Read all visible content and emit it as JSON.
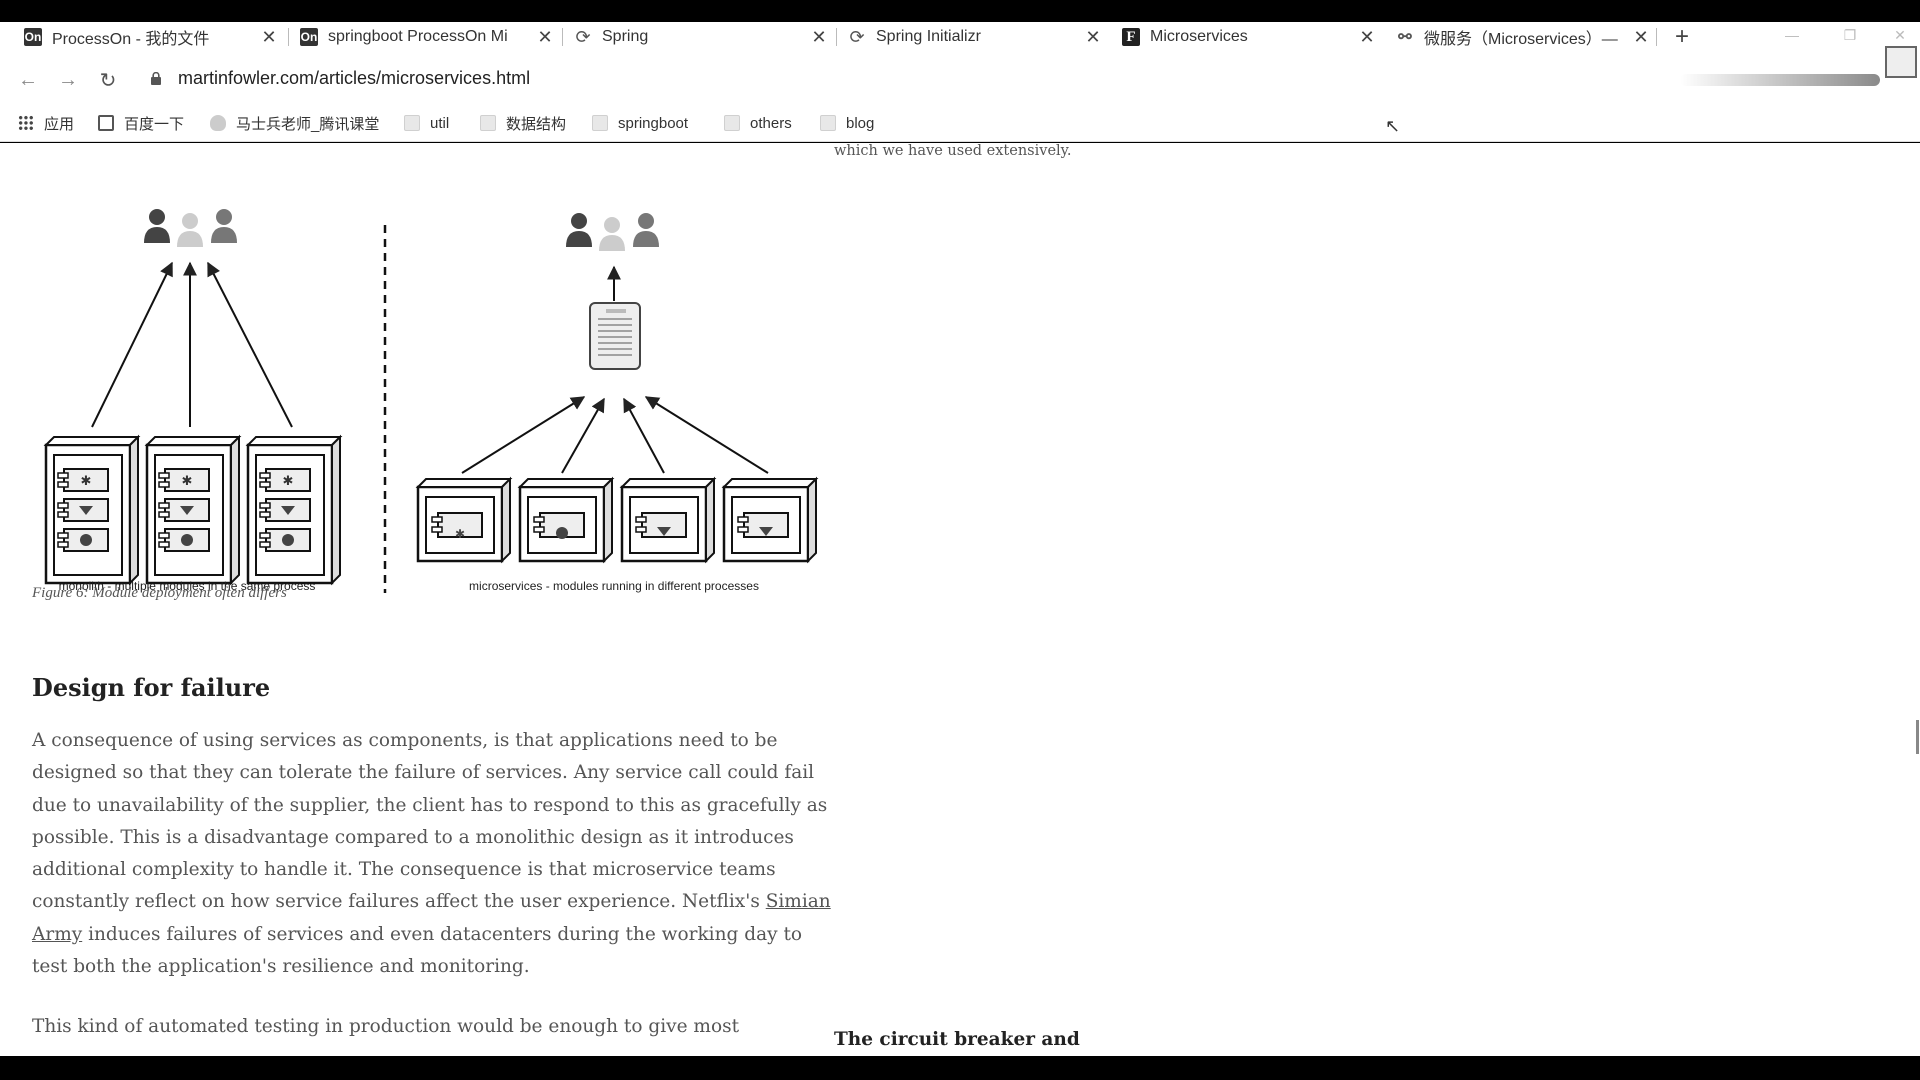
{
  "tabs": [
    {
      "title": "ProcessOn - 我的文件",
      "icon": "processon-icon"
    },
    {
      "title": "springboot ProcessOn Mi",
      "icon": "processon-icon"
    },
    {
      "title": "Spring",
      "icon": "spring-icon"
    },
    {
      "title": "Spring Initializr",
      "icon": "spring-initializr-icon"
    },
    {
      "title": "Microservices",
      "icon": "martinfowler-f-icon"
    },
    {
      "title": "微服务（Microservices）—",
      "icon": "link-icon"
    }
  ],
  "address": {
    "url": "martinfowler.com/articles/microservices.html"
  },
  "bookmarks": [
    {
      "label": "应用",
      "icon": "apps-grid-icon"
    },
    {
      "label": "百度一下",
      "icon": "baidu-icon"
    },
    {
      "label": "马士兵老师_腾讯课堂",
      "icon": "tencent-icon"
    },
    {
      "label": "util",
      "icon": "folder-icon"
    },
    {
      "label": "数据结构",
      "icon": "folder-icon"
    },
    {
      "label": "springboot",
      "icon": "folder-icon"
    },
    {
      "label": "others",
      "icon": "folder-icon"
    },
    {
      "label": "blog",
      "icon": "folder-icon"
    }
  ],
  "article": {
    "sidebar_top_fragment": "which we have used extensively.",
    "figure": {
      "left_caption": "monolith - multiple modules in the same process",
      "right_caption": "microservices - modules running in different processes",
      "caption": "Figure 6: Module deployment often differs"
    },
    "heading": "Design for failure",
    "para1": {
      "text_a": "A consequence of using services as components, is that applications need to be designed so that they can tolerate the failure of services. Any service call could fail due to unavailability of the supplier, the client has to respond to this as gracefully as possible. This is a disadvantage compared to a monolithic design as it introduces additional complexity to handle it. The consequence is that microservice teams constantly reflect on how service failures affect the user experience. Netflix's ",
      "link": "Simian Army",
      "text_b": " induces failures of services and even datacenters during the working day to test both the application's resilience and monitoring."
    },
    "para2": "This kind of automated testing in production would be enough to give most",
    "sidebar_heading": "The circuit breaker and"
  }
}
